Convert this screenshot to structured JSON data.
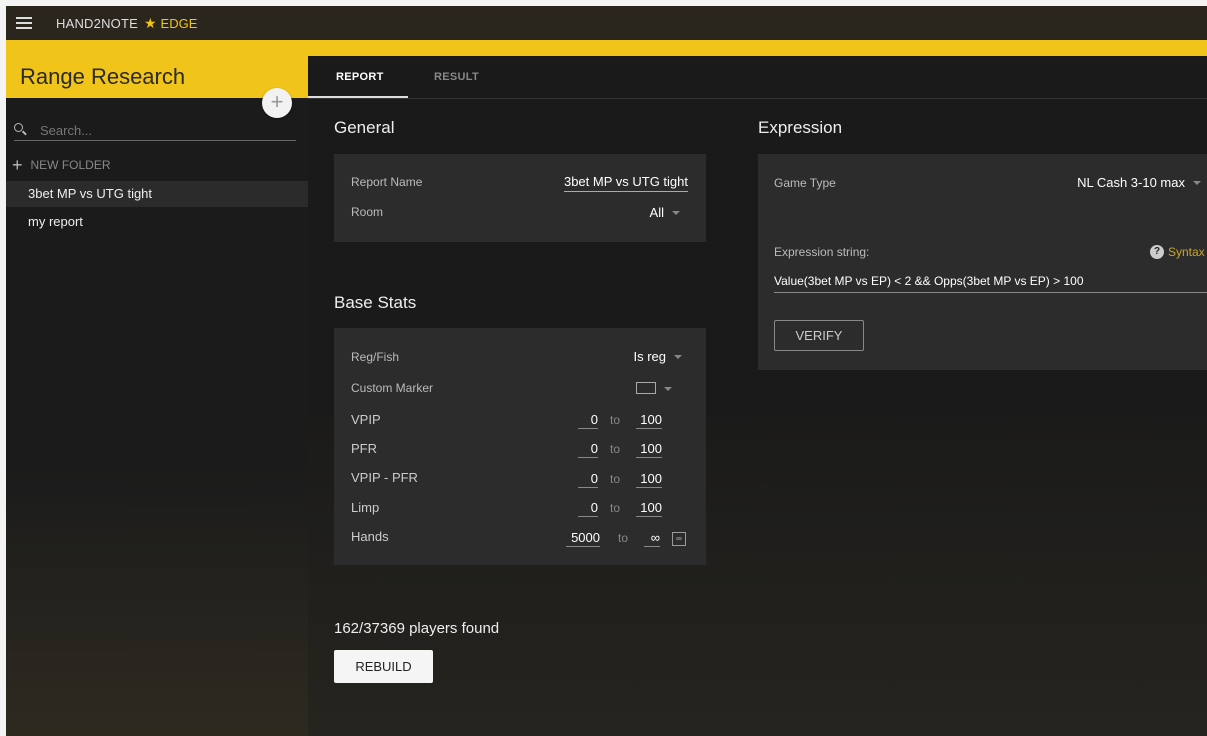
{
  "topbar": {
    "brand": "HAND2NOTE",
    "star": "★",
    "edge": "EDGE"
  },
  "sidebar": {
    "title": "Range Research",
    "add_icon": "+",
    "search_placeholder": "Search...",
    "new_folder_label": "NEW FOLDER",
    "items": [
      {
        "label": "3bet MP vs UTG tight",
        "active": true
      },
      {
        "label": "my report",
        "active": false
      }
    ]
  },
  "tabs": [
    {
      "label": "REPORT",
      "active": true
    },
    {
      "label": "RESULT",
      "active": false
    }
  ],
  "general": {
    "title": "General",
    "report_name_label": "Report Name",
    "report_name_value": "3bet MP vs UTG tight",
    "room_label": "Room",
    "room_value": "All"
  },
  "base_stats": {
    "title": "Base Stats",
    "reg_fish_label": "Reg/Fish",
    "reg_fish_value": "Is reg",
    "custom_marker_label": "Custom Marker",
    "to_label": "to",
    "rows": [
      {
        "label": "VPIP",
        "min": "0",
        "max": "100"
      },
      {
        "label": "PFR",
        "min": "0",
        "max": "100"
      },
      {
        "label": "VPIP - PFR",
        "min": "0",
        "max": "100"
      },
      {
        "label": "Limp",
        "min": "0",
        "max": "100"
      },
      {
        "label": "Hands",
        "min": "5000",
        "max": "∞"
      }
    ],
    "infinity_button": "∞"
  },
  "expression": {
    "title": "Expression",
    "game_type_label": "Game Type",
    "game_type_value": "NL Cash 3-10 max",
    "expr_label": "Expression string:",
    "help_icon": "?",
    "syntax_label": "Syntax",
    "expr_value": "Value(3bet MP vs EP) < 2 && Opps(3bet MP vs EP) > 100",
    "verify_label": "VERIFY"
  },
  "footer": {
    "players_found": "162/37369 players found",
    "rebuild_label": "REBUILD"
  }
}
